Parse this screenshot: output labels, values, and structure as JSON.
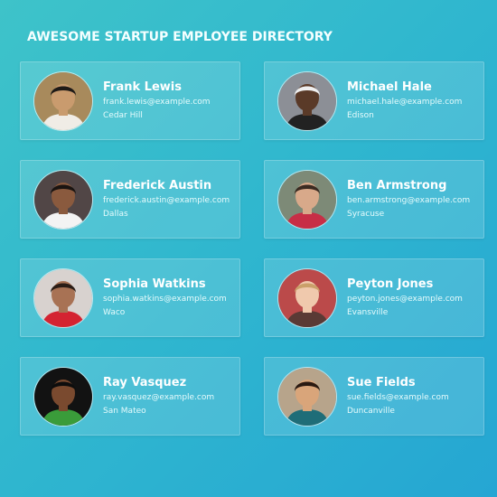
{
  "title": "AWESOME STARTUP EMPLOYEE DIRECTORY",
  "employees": [
    {
      "name": "Frank Lewis",
      "email": "frank.lewis@example.com",
      "city": "Cedar Hill",
      "bg": "#a88a5c",
      "skin": "#c99b6e",
      "hair": "#1e1a17",
      "shirt": "#f0ece6"
    },
    {
      "name": "Michael Hale",
      "email": "michael.hale@example.com",
      "city": "Edison",
      "bg": "#8c8f96",
      "skin": "#5a3a28",
      "hair": "#efefef",
      "shirt": "#222222"
    },
    {
      "name": "Frederick Austin",
      "email": "frederick.austin@example.com",
      "city": "Dallas",
      "bg": "#514646",
      "skin": "#8a5a3e",
      "hair": "#1a1411",
      "shirt": "#f3f3f3"
    },
    {
      "name": "Ben Armstrong",
      "email": "ben.armstrong@example.com",
      "city": "Syracuse",
      "bg": "#7d8a77",
      "skin": "#d8a98a",
      "hair": "#3a2b22",
      "shirt": "#c72e46"
    },
    {
      "name": "Sophia Watkins",
      "email": "sophia.watkins@example.com",
      "city": "Waco",
      "bg": "#d8d2cf",
      "skin": "#a87254",
      "hair": "#2a1d16",
      "shirt": "#d42331"
    },
    {
      "name": "Peyton Jones",
      "email": "peyton.jones@example.com",
      "city": "Evansville",
      "bg": "#bb4a4a",
      "skin": "#f0c9ad",
      "hair": "#caa06a",
      "shirt": "#5a3a35"
    },
    {
      "name": "Ray Vasquez",
      "email": "ray.vasquez@example.com",
      "city": "San Mateo",
      "bg": "#121212",
      "skin": "#7a4a2f",
      "hair": "#0d0d0d",
      "shirt": "#3a9c3a"
    },
    {
      "name": "Sue Fields",
      "email": "sue.fields@example.com",
      "city": "Duncanville",
      "bg": "#b7a48b",
      "skin": "#d9a57a",
      "hair": "#2a1a12",
      "shirt": "#1f6d78"
    }
  ]
}
